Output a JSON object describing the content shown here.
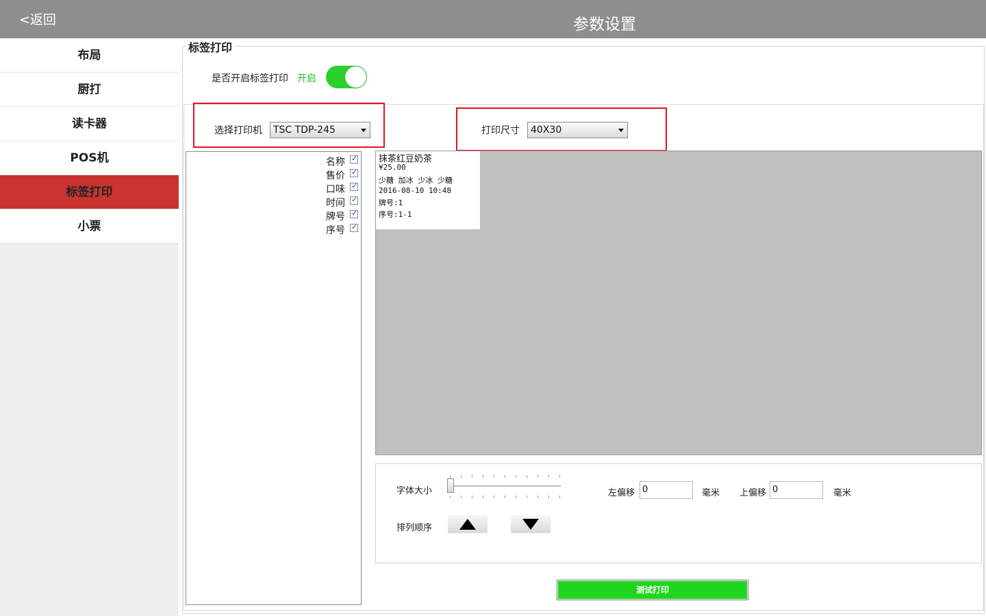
{
  "header": {
    "back_label": "<返回",
    "title": "参数设置"
  },
  "sidebar": {
    "items": [
      {
        "label": "布局"
      },
      {
        "label": "厨打"
      },
      {
        "label": "读卡器"
      },
      {
        "label": "POS机"
      },
      {
        "label": "标签打印",
        "active": true
      },
      {
        "label": "小票"
      }
    ]
  },
  "section": {
    "title": "标签打印",
    "toggle_label": "是否开启标签打印",
    "toggle_status": "开启",
    "toggle_on": true
  },
  "printer": {
    "label": "选择打印机",
    "value": "TSC TDP-245"
  },
  "size": {
    "label": "打印尺寸",
    "value": "40X30"
  },
  "fields": [
    {
      "name": "名称",
      "checked": true
    },
    {
      "name": "售价",
      "checked": true
    },
    {
      "name": "口味",
      "checked": true
    },
    {
      "name": "时间",
      "checked": true
    },
    {
      "name": "牌号",
      "checked": true
    },
    {
      "name": "序号",
      "checked": true
    }
  ],
  "preview": {
    "name": "抹茶红豆奶茶",
    "price": "¥25.00",
    "taste": "少糖 加冰 少冰 少糖",
    "time": "2016-08-10 10:48",
    "number": "牌号:1",
    "serial": "序号:1-1"
  },
  "controls": {
    "font_size_label": "字体大小",
    "font_size_value": 0,
    "left_offset_label": "左偏移",
    "left_offset_value": "0",
    "left_offset_unit": "毫米",
    "top_offset_label": "上偏移",
    "top_offset_value": "0",
    "top_offset_unit": "毫米",
    "order_label": "排列顺序"
  },
  "test_print_label": "测试打印",
  "colors": {
    "topbar": "#8e8e8e",
    "active_menu": "#c93431",
    "toggle_on": "#2ad12a",
    "status_text": "#22c02a",
    "test_button": "#1ed61e",
    "highlight_box": "#e3131a",
    "preview_bg": "#c0c0c0"
  }
}
